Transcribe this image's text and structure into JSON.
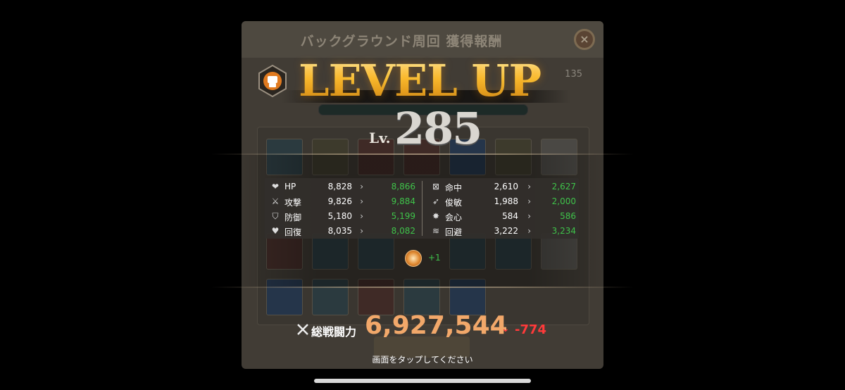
{
  "dialog": {
    "title": "バックグラウンド周回 獲得報酬",
    "close_icon": "×",
    "count": "135"
  },
  "level_up": {
    "heading": "LEVEL UP",
    "level_prefix": "Lv.",
    "level": "285",
    "xp_fraction": 0.0
  },
  "stats": {
    "left": [
      {
        "icon": "heart-icon",
        "label": "HP",
        "old": "8,828",
        "new": "8,866"
      },
      {
        "icon": "sword-icon",
        "label": "攻撃",
        "old": "9,826",
        "new": "9,884"
      },
      {
        "icon": "shield-icon",
        "label": "防御",
        "old": "5,180",
        "new": "5,199"
      },
      {
        "icon": "heal-icon",
        "label": "回復",
        "old": "8,035",
        "new": "8,082"
      }
    ],
    "right": [
      {
        "icon": "target-icon",
        "label": "命中",
        "old": "2,610",
        "new": "2,627"
      },
      {
        "icon": "agility-icon",
        "label": "俊敏",
        "old": "1,988",
        "new": "2,000"
      },
      {
        "icon": "critical-icon",
        "label": "会心",
        "old": "584",
        "new": "586"
      },
      {
        "icon": "evade-icon",
        "label": "回避",
        "old": "3,222",
        "new": "3,234"
      }
    ],
    "arrow": "›"
  },
  "skill": {
    "icon": "fist-skill-icon",
    "bonus": "+1"
  },
  "power": {
    "label": "総戦闘力",
    "value": "6,927,544",
    "diff": "-774",
    "diff_icon": "double-chevron-down-icon"
  },
  "hint": "画面をタップしてください",
  "colors": {
    "increase": "#3fc24a",
    "decrease": "#ff3a3a",
    "power_value": "#f2a86a",
    "level_gold": "#f5c23a"
  }
}
